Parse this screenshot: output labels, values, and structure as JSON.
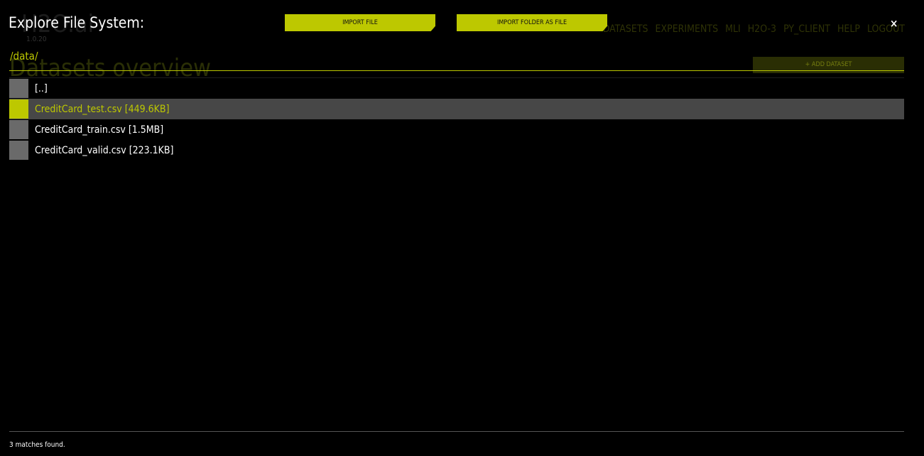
{
  "background": {
    "logo": "H2O.ai",
    "version": "1.0.20",
    "page_title": "Datasets overview",
    "nav": [
      "DATASETS",
      "EXPERIMENTS",
      "MLI",
      "H2O-3",
      "PY_CLIENT",
      "HELP",
      "LOGOUT"
    ],
    "add_dataset": "+ ADD DATASET"
  },
  "dialog": {
    "title": "Explore File System:",
    "import_file": "IMPORT FILE",
    "import_folder": "IMPORT FOLDER AS FILE",
    "close": "×",
    "path": "/data/",
    "items": [
      {
        "label": "[..]",
        "selected": false
      },
      {
        "label": "CreditCard_test.csv [449.6KB]",
        "selected": true
      },
      {
        "label": "CreditCard_train.csv [1.5MB]",
        "selected": false
      },
      {
        "label": "CreditCard_valid.csv [223.1KB]",
        "selected": false
      }
    ],
    "status": "3 matches found."
  },
  "colors": {
    "accent": "#bdc800",
    "selected_row": "#474747",
    "icon": "#6a6a6a"
  }
}
